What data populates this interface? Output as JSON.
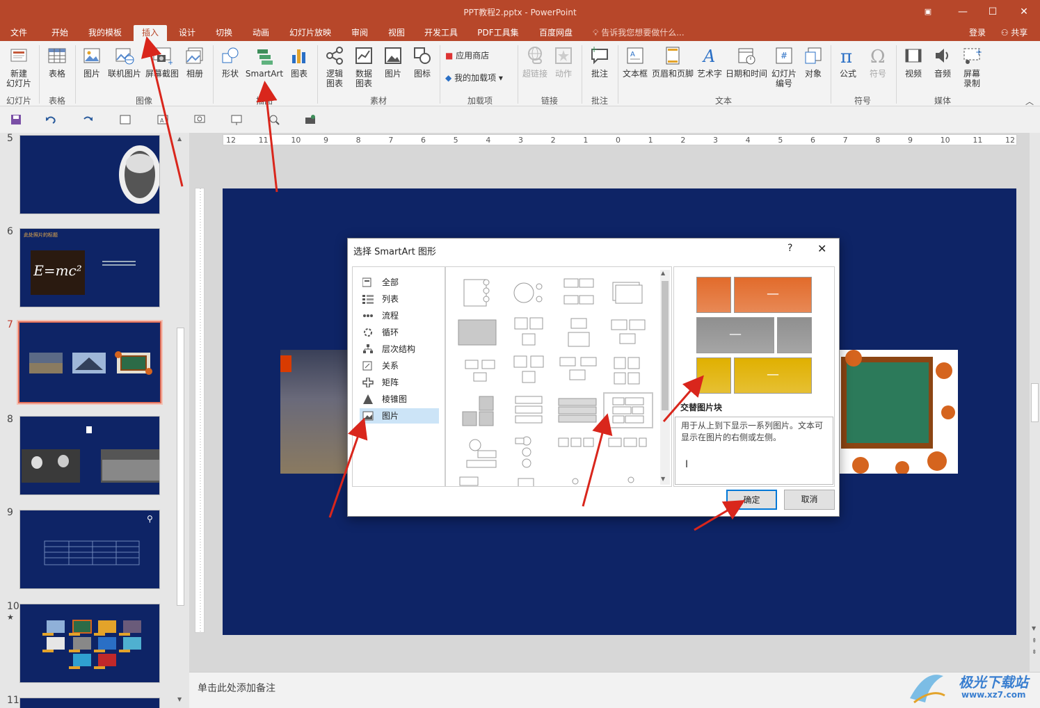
{
  "window": {
    "title": "PPT教程2.pptx - PowerPoint"
  },
  "menu": {
    "tabs": [
      "文件",
      "开始",
      "我的模板",
      "插入",
      "设计",
      "切换",
      "动画",
      "幻灯片放映",
      "审阅",
      "视图",
      "开发工具",
      "PDF工具集",
      "百度网盘"
    ],
    "active": "插入",
    "tell_me": "告诉我您想要做什么...",
    "login": "登录",
    "share": "共享"
  },
  "ribbon": {
    "buttons": {
      "new_slide": "新建\n幻灯片",
      "table": "表格",
      "picture": "图片",
      "online_picture": "联机图片",
      "screenshot": "屏幕截图",
      "album": "相册",
      "shapes": "形状",
      "smartart": "SmartArt",
      "chart": "图表",
      "logic_chart": "逻辑\n图表",
      "data_chart": "数据\n图表",
      "picture2": "图片",
      "icon": "图标",
      "app_store": "应用商店",
      "my_addins": "我的加载项",
      "hyperlink": "超链接",
      "action": "动作",
      "comment": "批注",
      "textbox": "文本框",
      "header_footer": "页眉和页脚",
      "wordart": "艺术字",
      "date_time": "日期和时间",
      "slide_number": "幻灯片\n编号",
      "object": "对象",
      "equation": "公式",
      "symbol": "符号",
      "video": "视频",
      "audio": "音频",
      "screen_record": "屏幕\n录制"
    },
    "groups": {
      "slides": "幻灯片",
      "tables": "表格",
      "images": "图像",
      "illustrations": "插图",
      "material": "素材",
      "addins": "加载项",
      "links": "链接",
      "comments": "批注",
      "text": "文本",
      "symbols": "符号",
      "media": "媒体"
    }
  },
  "slides": [
    {
      "num": "5"
    },
    {
      "num": "6",
      "title": "此处照片的标题",
      "formula": "E=mc²"
    },
    {
      "num": "7"
    },
    {
      "num": "8"
    },
    {
      "num": "9"
    },
    {
      "num": "10",
      "star": "★"
    },
    {
      "num": "11"
    }
  ],
  "ruler": {
    "h_ticks": [
      "12",
      "11",
      "10",
      "9",
      "8",
      "7",
      "6",
      "5",
      "4",
      "3",
      "2",
      "1",
      "0",
      "1",
      "2",
      "3",
      "4",
      "5",
      "6",
      "7",
      "8",
      "9",
      "10",
      "11",
      "12"
    ]
  },
  "notes": {
    "placeholder": "单击此处添加备注"
  },
  "dialog": {
    "title": "选择 SmartArt 图形",
    "help": "?",
    "close": "✕",
    "categories": [
      "全部",
      "列表",
      "流程",
      "循环",
      "层次结构",
      "关系",
      "矩阵",
      "棱锥图",
      "图片"
    ],
    "selected_category": "图片",
    "preview_title": "交替图片块",
    "preview_desc": "用于从上到下显示一系列图片。文本可显示在图片的右侧或左侧。",
    "ok": "确定",
    "cancel": "取消",
    "preview_colors": [
      "#e26b2b",
      "#8f8f8f",
      "#e0b000"
    ]
  },
  "watermark": {
    "text": "极光下载站",
    "url": "www.xz7.com"
  }
}
